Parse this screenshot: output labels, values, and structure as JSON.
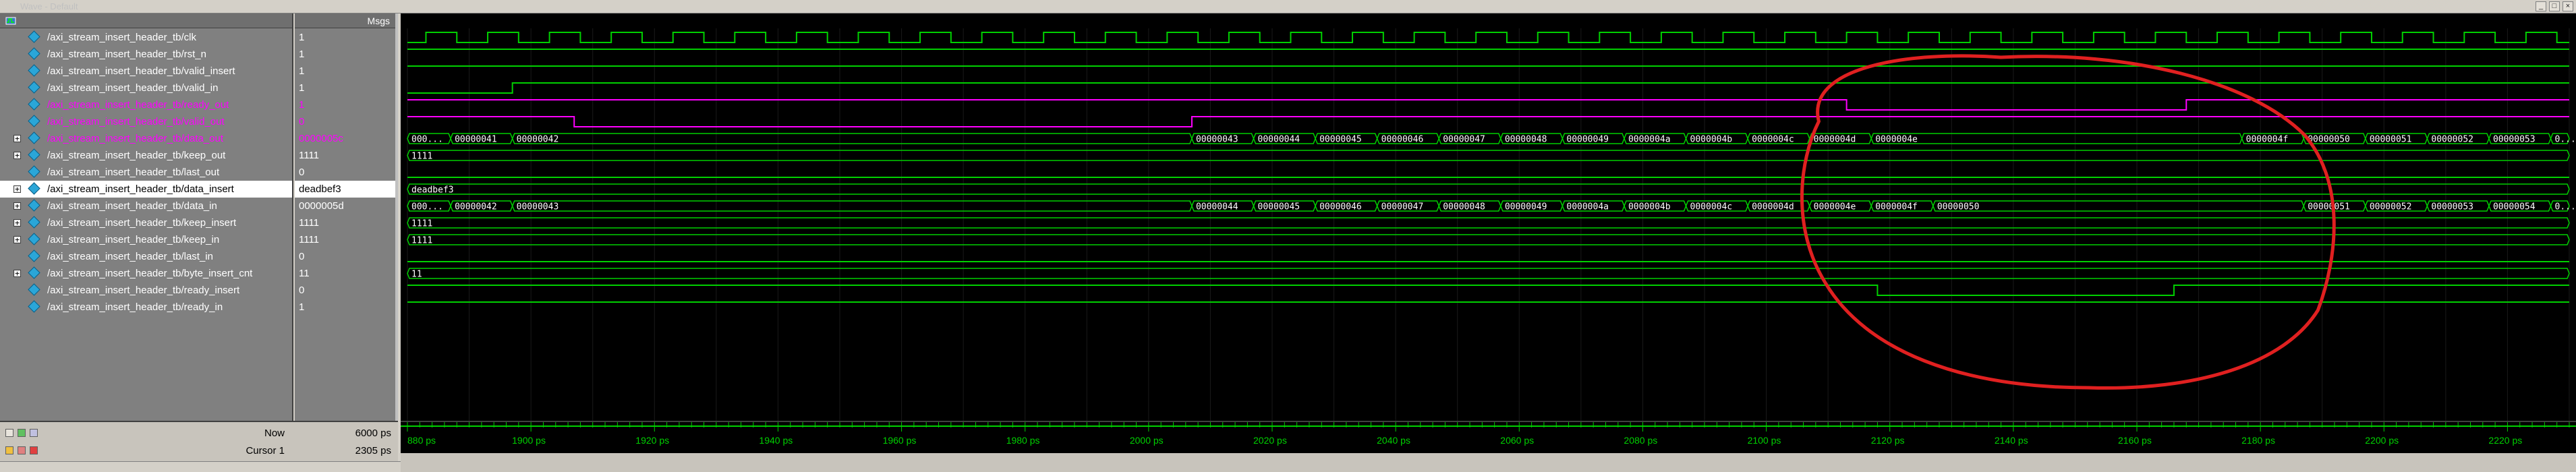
{
  "window": {
    "title": "Wave - Default",
    "controls": [
      "_",
      "□",
      "×"
    ]
  },
  "values_header": "Msgs",
  "signals": [
    {
      "name": "/axi_stream_insert_header_tb/clk",
      "value": "1",
      "expandable": false,
      "color": "#ffffff"
    },
    {
      "name": "/axi_stream_insert_header_tb/rst_n",
      "value": "1",
      "expandable": false,
      "color": "#ffffff"
    },
    {
      "name": "/axi_stream_insert_header_tb/valid_insert",
      "value": "1",
      "expandable": false,
      "color": "#ffffff"
    },
    {
      "name": "/axi_stream_insert_header_tb/valid_in",
      "value": "1",
      "expandable": false,
      "color": "#ffffff"
    },
    {
      "name": "/axi_stream_insert_header_tb/ready_out",
      "value": "1",
      "expandable": false,
      "color": "#ff00ff"
    },
    {
      "name": "/axi_stream_insert_header_tb/valid_out",
      "value": "0",
      "expandable": false,
      "color": "#ff00ff"
    },
    {
      "name": "/axi_stream_insert_header_tb/data_out",
      "value": "0000005c",
      "expandable": true,
      "color": "#ff00ff"
    },
    {
      "name": "/axi_stream_insert_header_tb/keep_out",
      "value": "1111",
      "expandable": true,
      "color": "#ffffff"
    },
    {
      "name": "/axi_stream_insert_header_tb/last_out",
      "value": "0",
      "expandable": false,
      "color": "#ffffff"
    },
    {
      "name": "/axi_stream_insert_header_tb/data_insert",
      "value": "deadbef3",
      "expandable": true,
      "color": "#000000",
      "selected": true
    },
    {
      "name": "/axi_stream_insert_header_tb/data_in",
      "value": "0000005d",
      "expandable": true,
      "color": "#ffffff"
    },
    {
      "name": "/axi_stream_insert_header_tb/keep_insert",
      "value": "1111",
      "expandable": true,
      "color": "#ffffff"
    },
    {
      "name": "/axi_stream_insert_header_tb/keep_in",
      "value": "1111",
      "expandable": true,
      "color": "#ffffff"
    },
    {
      "name": "/axi_stream_insert_header_tb/last_in",
      "value": "0",
      "expandable": false,
      "color": "#ffffff"
    },
    {
      "name": "/axi_stream_insert_header_tb/byte_insert_cnt",
      "value": "11",
      "expandable": true,
      "color": "#ffffff"
    },
    {
      "name": "/axi_stream_insert_header_tb/ready_insert",
      "value": "0",
      "expandable": false,
      "color": "#ffffff"
    },
    {
      "name": "/axi_stream_insert_header_tb/ready_in",
      "value": "1",
      "expandable": false,
      "color": "#ffffff"
    }
  ],
  "waves": {
    "t_start": 1880,
    "t_end": 2230,
    "clk_period": 10,
    "clk_first_rise": 1883,
    "rst_n": {
      "high": true
    },
    "valid_insert": {
      "high": true
    },
    "valid_in": {
      "low_until": 1897,
      "then": "high"
    },
    "ready_out": {
      "edges": [
        [
          1880,
          1
        ],
        [
          2113,
          0
        ],
        [
          2168,
          1
        ]
      ]
    },
    "valid_out": {
      "edges": [
        [
          1880,
          1
        ],
        [
          1907,
          0
        ],
        [
          2007,
          1
        ]
      ]
    },
    "data_out_segments": [
      {
        "t0": 1880,
        "t1": 1887,
        "label": "000..."
      },
      {
        "t0": 1887,
        "t1": 1897,
        "label": "00000041"
      },
      {
        "t0": 1897,
        "t1": 2007,
        "label": "00000042"
      },
      {
        "t0": 2007,
        "t1": 2017,
        "label": "00000043"
      },
      {
        "t0": 2017,
        "t1": 2027,
        "label": "00000044"
      },
      {
        "t0": 2027,
        "t1": 2037,
        "label": "00000045"
      },
      {
        "t0": 2037,
        "t1": 2047,
        "label": "00000046"
      },
      {
        "t0": 2047,
        "t1": 2057,
        "label": "00000047"
      },
      {
        "t0": 2057,
        "t1": 2067,
        "label": "00000048"
      },
      {
        "t0": 2067,
        "t1": 2077,
        "label": "00000049"
      },
      {
        "t0": 2077,
        "t1": 2087,
        "label": "0000004a"
      },
      {
        "t0": 2087,
        "t1": 2097,
        "label": "0000004b"
      },
      {
        "t0": 2097,
        "t1": 2107,
        "label": "0000004c"
      },
      {
        "t0": 2107,
        "t1": 2117,
        "label": "0000004d"
      },
      {
        "t0": 2117,
        "t1": 2177,
        "label": "0000004e"
      },
      {
        "t0": 2177,
        "t1": 2187,
        "label": "0000004f"
      },
      {
        "t0": 2187,
        "t1": 2197,
        "label": "00000050"
      },
      {
        "t0": 2197,
        "t1": 2207,
        "label": "00000051"
      },
      {
        "t0": 2207,
        "t1": 2217,
        "label": "00000052"
      },
      {
        "t0": 2217,
        "t1": 2227,
        "label": "00000053"
      },
      {
        "t0": 2227,
        "t1": 2230,
        "label": "0..."
      }
    ],
    "keep_out_label": "1111",
    "last_out": {
      "high": false
    },
    "data_insert_label": "deadbef3",
    "data_in_segments": [
      {
        "t0": 1880,
        "t1": 1887,
        "label": "000..."
      },
      {
        "t0": 1887,
        "t1": 1897,
        "label": "00000042"
      },
      {
        "t0": 1897,
        "t1": 2007,
        "label": "00000043"
      },
      {
        "t0": 2007,
        "t1": 2017,
        "label": "00000044"
      },
      {
        "t0": 2017,
        "t1": 2027,
        "label": "00000045"
      },
      {
        "t0": 2027,
        "t1": 2037,
        "label": "00000046"
      },
      {
        "t0": 2037,
        "t1": 2047,
        "label": "00000047"
      },
      {
        "t0": 2047,
        "t1": 2057,
        "label": "00000048"
      },
      {
        "t0": 2057,
        "t1": 2067,
        "label": "00000049"
      },
      {
        "t0": 2067,
        "t1": 2077,
        "label": "0000004a"
      },
      {
        "t0": 2077,
        "t1": 2087,
        "label": "0000004b"
      },
      {
        "t0": 2087,
        "t1": 2097,
        "label": "0000004c"
      },
      {
        "t0": 2097,
        "t1": 2107,
        "label": "0000004d"
      },
      {
        "t0": 2107,
        "t1": 2117,
        "label": "0000004e"
      },
      {
        "t0": 2117,
        "t1": 2127,
        "label": "0000004f"
      },
      {
        "t0": 2127,
        "t1": 2187,
        "label": "00000050"
      },
      {
        "t0": 2187,
        "t1": 2197,
        "label": "00000051"
      },
      {
        "t0": 2197,
        "t1": 2207,
        "label": "00000052"
      },
      {
        "t0": 2207,
        "t1": 2217,
        "label": "00000053"
      },
      {
        "t0": 2217,
        "t1": 2227,
        "label": "00000054"
      },
      {
        "t0": 2227,
        "t1": 2230,
        "label": "0..."
      }
    ],
    "keep_insert_label": "1111",
    "keep_in_label": "1111",
    "last_in": {
      "high": false
    },
    "byte_insert_cnt_label": "11",
    "ready_insert": {
      "edges": [
        [
          1880,
          1
        ],
        [
          2118,
          0
        ],
        [
          2166,
          1
        ]
      ]
    },
    "ready_in": {
      "high": true
    }
  },
  "timeline": {
    "ticks": [
      {
        "t": 1880,
        "label": "880 ps"
      },
      {
        "t": 1900,
        "label": "1900 ps"
      },
      {
        "t": 1920,
        "label": "1920 ps"
      },
      {
        "t": 1940,
        "label": "1940 ps"
      },
      {
        "t": 1960,
        "label": "1960 ps"
      },
      {
        "t": 1980,
        "label": "1980 ps"
      },
      {
        "t": 2000,
        "label": "2000 ps"
      },
      {
        "t": 2020,
        "label": "2020 ps"
      },
      {
        "t": 2040,
        "label": "2040 ps"
      },
      {
        "t": 2060,
        "label": "2060 ps"
      },
      {
        "t": 2080,
        "label": "2080 ps"
      },
      {
        "t": 2100,
        "label": "2100 ps"
      },
      {
        "t": 2120,
        "label": "2120 ps"
      },
      {
        "t": 2140,
        "label": "2140 ps"
      },
      {
        "t": 2160,
        "label": "2160 ps"
      },
      {
        "t": 2180,
        "label": "2180 ps"
      },
      {
        "t": 2200,
        "label": "2200 ps"
      },
      {
        "t": 2220,
        "label": "2220 ps"
      }
    ]
  },
  "status": {
    "now_label": "Now",
    "now_value": "6000 ps",
    "cursor_label": "Cursor 1",
    "cursor_value": "2305 ps"
  },
  "colors": {
    "wave_green": "#00d000",
    "wave_magenta": "#ff00ff",
    "bus_text": "#ffffff",
    "annotation_red": "#e02020"
  },
  "annotation": {
    "shape": "red-ellipse",
    "t_center": 2150
  }
}
